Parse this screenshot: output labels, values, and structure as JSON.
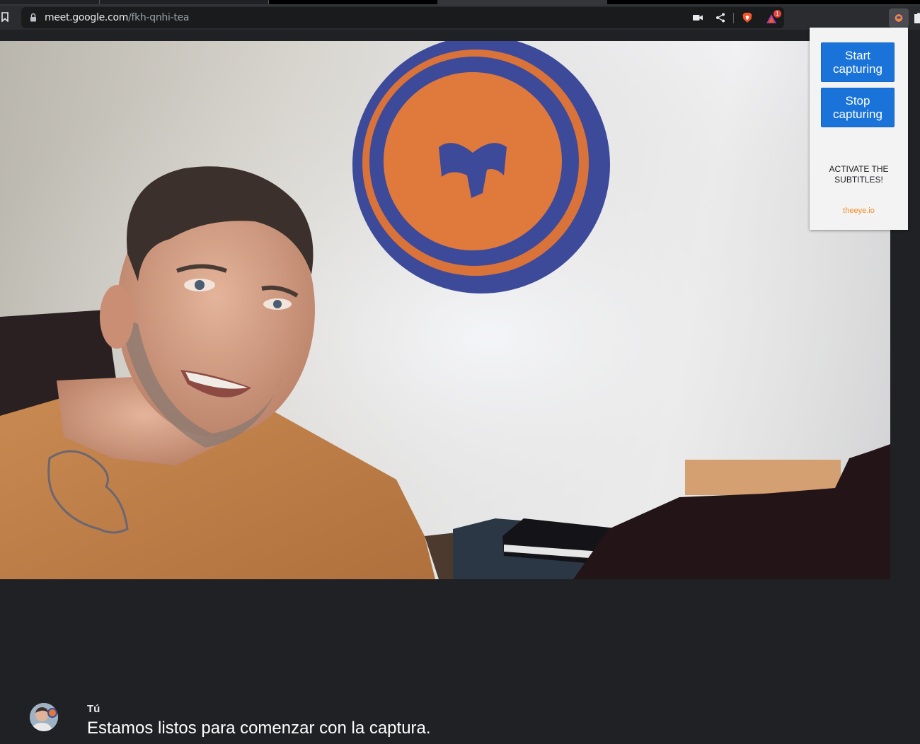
{
  "browser": {
    "url_host": "meet.google.com",
    "url_path": "/fkh-qnhi-tea",
    "notification_count": "1",
    "icons": [
      "bookmark-icon",
      "lock-icon",
      "camera-icon",
      "share-icon",
      "brave-shield-icon",
      "brave-rewards-icon",
      "extension-icon",
      "puzzle-icon"
    ]
  },
  "popup": {
    "start_label": "Start capturing",
    "stop_label": "Stop capturing",
    "note": "ACTIVATE THE SUBTITLES!",
    "link_text": "theeye.io",
    "accent_color": "#1a73d8",
    "link_color": "#f28b26"
  },
  "captions": {
    "speaker": "Tú",
    "text": "Estamos listos para comenzar con la captura."
  }
}
